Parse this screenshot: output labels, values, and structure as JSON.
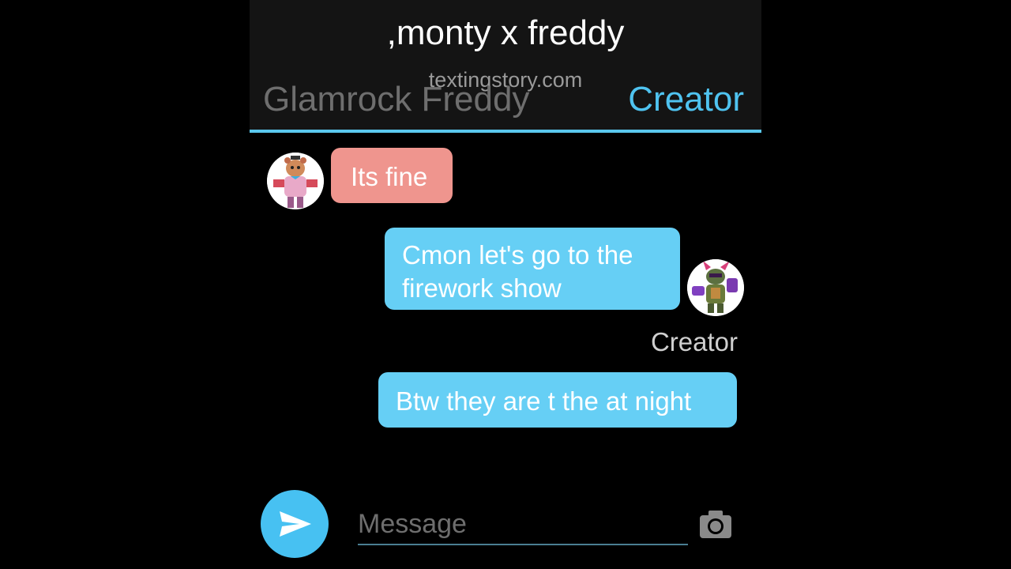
{
  "header": {
    "title": ",monty x freddy",
    "watermark": "textingstory.com",
    "left_name": "Glamrock Freddy",
    "right_name": "Creator"
  },
  "messages": [
    {
      "side": "left",
      "text": "Its fine",
      "avatar": "glamrock-freddy"
    },
    {
      "side": "right",
      "text_lines": [
        "Cmon let's go to the",
        "firework show"
      ],
      "avatar": "monty"
    },
    {
      "side": "right",
      "text": "Btw they are t the at night",
      "sender": "Creator"
    }
  ],
  "input": {
    "placeholder": "Message"
  },
  "colors": {
    "accent": "#5ac8ee",
    "left_bubble": "#ef958e",
    "right_bubble": "#66cff5",
    "send_button": "#47c1f2"
  }
}
